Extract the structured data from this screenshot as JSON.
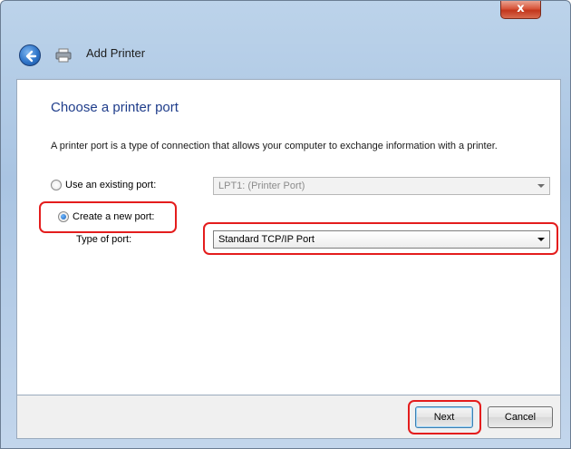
{
  "window": {
    "close_glyph": "x"
  },
  "nav": {
    "title": "Add Printer"
  },
  "main": {
    "heading": "Choose a printer port",
    "description": "A printer port is a type of connection that allows your computer to exchange information with a printer.",
    "existing_port": {
      "label": "Use an existing port:",
      "value": "LPT1: (Printer Port)"
    },
    "new_port": {
      "label": "Create a new port:",
      "type_label": "Type of port:",
      "value": "Standard TCP/IP Port"
    }
  },
  "footer": {
    "next_label": "Next",
    "cancel_label": "Cancel"
  },
  "colors": {
    "highlight": "#e41d1d",
    "heading": "#1f3d8b"
  }
}
